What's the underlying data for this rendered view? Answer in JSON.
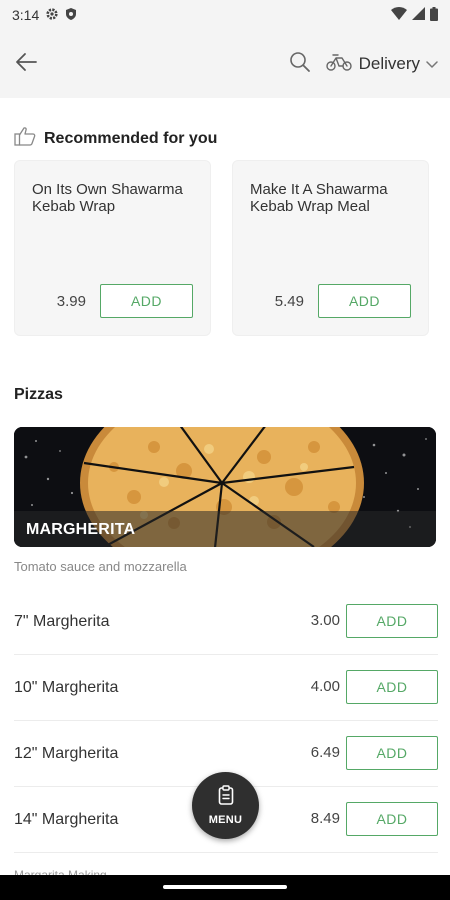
{
  "status_bar": {
    "time": "3:14"
  },
  "header": {
    "delivery_label": "Delivery"
  },
  "recommended": {
    "title": "Recommended for you",
    "items": [
      {
        "name": "On Its Own Shawarma Kebab Wrap",
        "price": "3.99",
        "add_label": "ADD"
      },
      {
        "name": "Make It A Shawarma Kebab Wrap Meal",
        "price": "5.49",
        "add_label": "ADD"
      }
    ]
  },
  "pizzas": {
    "title": "Pizzas",
    "banner_title": "MARGHERITA",
    "description": "Tomato sauce and mozzarella",
    "items": [
      {
        "name": "7\" Margherita",
        "price": "3.00",
        "add_label": "ADD"
      },
      {
        "name": "10\" Margherita",
        "price": "4.00",
        "add_label": "ADD"
      },
      {
        "name": "12\" Margherita",
        "price": "6.49",
        "add_label": "ADD"
      },
      {
        "name": "14\" Margherita",
        "price": "8.49",
        "add_label": "ADD"
      }
    ],
    "next_item_partial": "Margarita Making"
  },
  "fab": {
    "label": "MENU"
  },
  "colors": {
    "accent_green": "#55a866",
    "fab_bg": "#2f2f2f"
  }
}
